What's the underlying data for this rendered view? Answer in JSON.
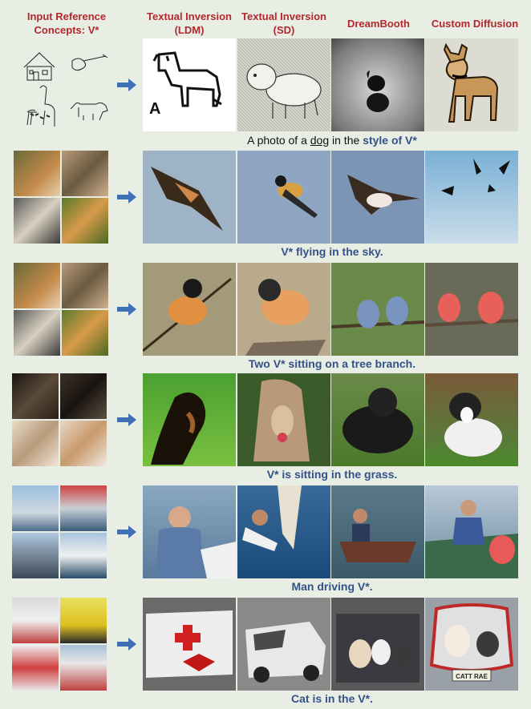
{
  "headers": {
    "input": "Input Reference Concepts: V*",
    "col1": "Textual Inversion (LDM)",
    "col2": "Textual Inversion (SD)",
    "col3": "DreamBooth",
    "col4": "Custom Diffusion"
  },
  "rows": [
    {
      "caption_prefix": "A photo of a ",
      "caption_underlined": "dog",
      "caption_mid": " in the ",
      "caption_style": "style of V*"
    },
    {
      "caption": "V* flying in the sky."
    },
    {
      "caption": "Two V* sitting on a tree branch."
    },
    {
      "caption": "V* is sitting in the grass."
    },
    {
      "caption": "Man driving V*."
    },
    {
      "caption": "Cat is in the V*."
    }
  ],
  "row1_sketch_label": "A",
  "row6_gen4_plate": "CATT RAE",
  "colors": {
    "header": "#b2282e",
    "caption": "#34528a",
    "arrow": "#3f6fb5",
    "background": "#e8eee3"
  },
  "icons": [
    "arrow-right-icon"
  ]
}
